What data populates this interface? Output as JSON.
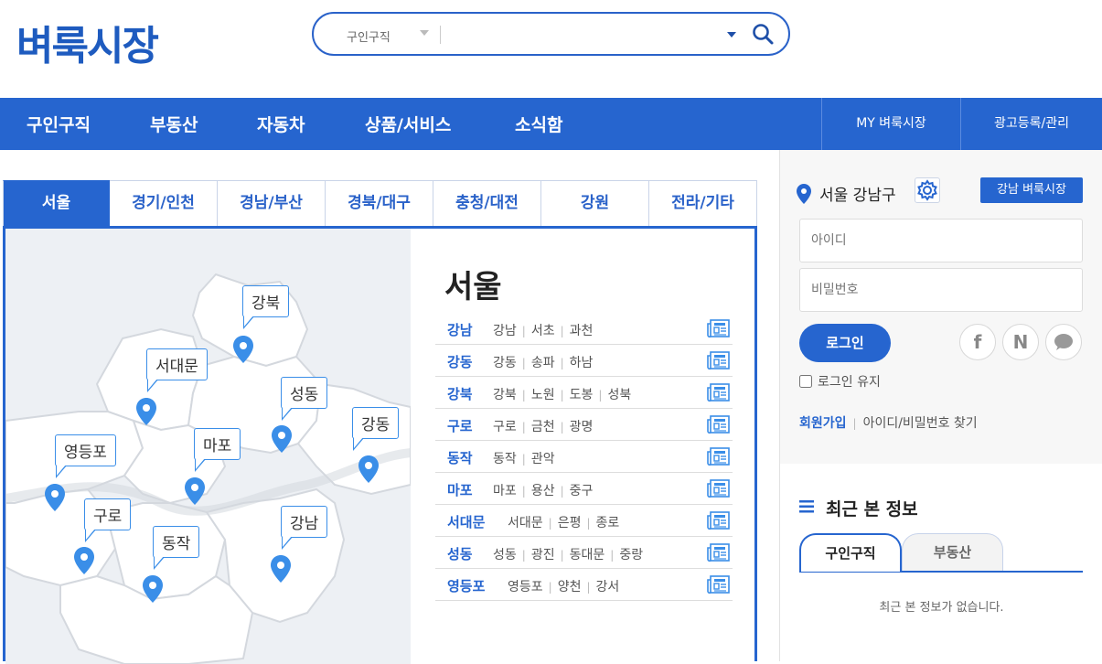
{
  "header": {
    "logo": "벼룩시장",
    "search": {
      "category": "구인구직",
      "value": "",
      "placeholder": ""
    }
  },
  "nav": {
    "items": [
      "구인구직",
      "부동산",
      "자동차",
      "상품/서비스",
      "소식함"
    ],
    "right": [
      "MY 벼룩시장",
      "광고등록/관리"
    ]
  },
  "region": {
    "tabs": [
      "서울",
      "경기/인천",
      "경남/부산",
      "경북/대구",
      "충청/대전",
      "강원",
      "전라/기타"
    ],
    "active_tab": "서울",
    "map_labels": [
      "강북",
      "서대문",
      "성동",
      "강동",
      "영등포",
      "마포",
      "구로",
      "동작",
      "강남"
    ],
    "title": "서울",
    "rows": [
      {
        "name": "강남",
        "subs": [
          "강남",
          "서초",
          "과천"
        ]
      },
      {
        "name": "강동",
        "subs": [
          "강동",
          "송파",
          "하남"
        ]
      },
      {
        "name": "강북",
        "subs": [
          "강북",
          "노원",
          "도봉",
          "성북"
        ]
      },
      {
        "name": "구로",
        "subs": [
          "구로",
          "금천",
          "광명"
        ]
      },
      {
        "name": "동작",
        "subs": [
          "동작",
          "관악"
        ]
      },
      {
        "name": "마포",
        "subs": [
          "마포",
          "용산",
          "중구"
        ]
      },
      {
        "name": "서대문",
        "subs": [
          "서대문",
          "은평",
          "종로"
        ]
      },
      {
        "name": "성동",
        "subs": [
          "성동",
          "광진",
          "동대문",
          "중랑"
        ]
      },
      {
        "name": "영등포",
        "subs": [
          "영등포",
          "양천",
          "강서"
        ]
      }
    ]
  },
  "sidebar": {
    "location": "서울 강남구",
    "local_button": "강남 벼룩시장",
    "id_placeholder": "아이디",
    "pw_placeholder": "비밀번호",
    "login_label": "로그인",
    "social": [
      "f",
      "N",
      "chat"
    ],
    "keep_label": "로그인 유지",
    "join_label": "회원가입",
    "find_label": "아이디/비밀번호 찾기",
    "recent_title": "최근 본 정보",
    "recent_tabs": [
      "구인구직",
      "부동산"
    ],
    "recent_empty": "최근 본 정보가 없습니다."
  },
  "colors": {
    "brand": "#2665cf",
    "pin": "#3a8ee8",
    "map_bg": "#edf0f4"
  }
}
